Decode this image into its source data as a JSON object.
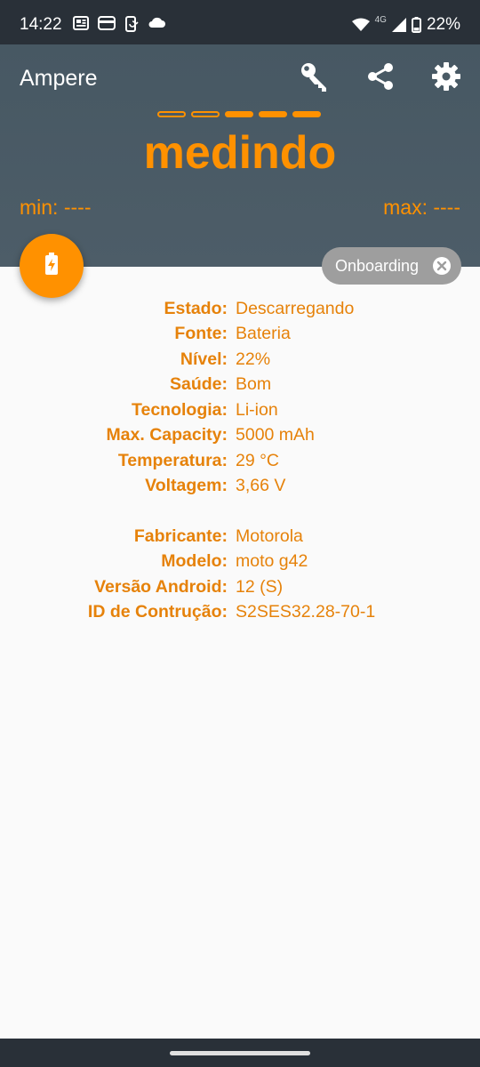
{
  "status_bar": {
    "time": "14:22",
    "network": "4G",
    "battery": "22%",
    "left_icons": [
      "news-icon",
      "card-icon",
      "phone-sync-icon",
      "cloud-icon"
    ],
    "right_icons": [
      "wifi-icon",
      "signal-icon",
      "battery-icon"
    ]
  },
  "appbar": {
    "title": "Ampere",
    "actions": [
      "key-icon",
      "share-icon",
      "settings-icon"
    ],
    "measuring_text": "medindo",
    "progress_dots": {
      "total": 5,
      "filled": 3
    },
    "min_text": "min: ----",
    "max_text": "max: ----"
  },
  "fab": {
    "icon": "battery-charging-icon"
  },
  "chip": {
    "label": "Onboarding",
    "icon": "close-circle-icon"
  },
  "battery_info": [
    {
      "label": "Estado:",
      "value": "Descarregando"
    },
    {
      "label": "Fonte:",
      "value": "Bateria"
    },
    {
      "label": "Nível:",
      "value": "22%"
    },
    {
      "label": "Saúde:",
      "value": "Bom"
    },
    {
      "label": "Tecnologia:",
      "value": "Li-ion"
    },
    {
      "label": "Max. Capacity:",
      "value": "5000 mAh"
    },
    {
      "label": "Temperatura:",
      "value": "29 °C"
    },
    {
      "label": "Voltagem:",
      "value": "3,66 V"
    }
  ],
  "device_info": [
    {
      "label": "Fabricante:",
      "value": "Motorola"
    },
    {
      "label": "Modelo:",
      "value": "moto g42"
    },
    {
      "label": "Versão Android:",
      "value": "12 (S)"
    },
    {
      "label": "ID de Contrução:",
      "value": "S2SES32.28-70-1"
    }
  ],
  "colors": {
    "accent": "#ff9100",
    "text_accent": "#e6820a",
    "appbar_bg": "#4a5b66",
    "system_bar_bg": "#293038",
    "chip_bg": "#9e9e9e",
    "content_bg": "#fafafa"
  }
}
